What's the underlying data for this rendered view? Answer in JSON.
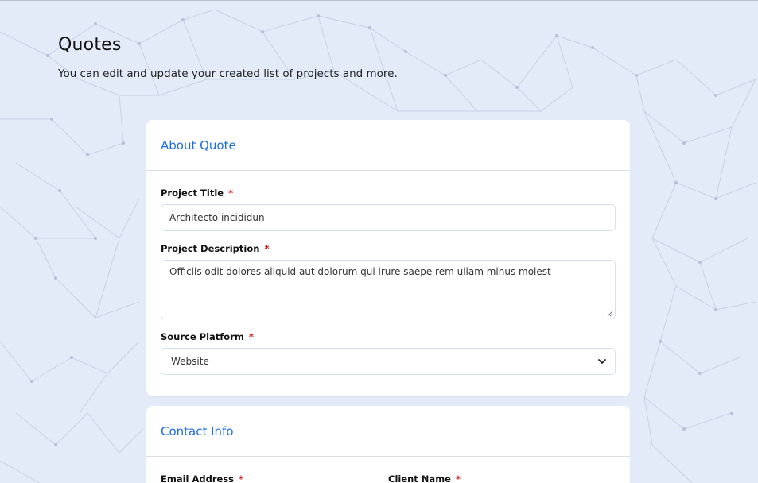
{
  "page": {
    "title": "Quotes",
    "subtitle": "You can edit and update your created list of projects and more."
  },
  "about_quote": {
    "heading": "About Quote",
    "project_title": {
      "label": "Project Title",
      "required_mark": "*",
      "value": "Architecto incididun"
    },
    "project_description": {
      "label": "Project Description",
      "required_mark": "*",
      "value": "Officiis odit dolores aliquid aut dolorum qui irure saepe rem ullam minus molest"
    },
    "source_platform": {
      "label": "Source Platform",
      "required_mark": "*",
      "selected": "Website"
    }
  },
  "contact_info": {
    "heading": "Contact Info",
    "email": {
      "label": "Email Address",
      "required_mark": "*"
    },
    "client_name": {
      "label": "Client Name",
      "required_mark": "*"
    }
  },
  "colors": {
    "background": "#e4ebf8",
    "accent": "#1f6fe0",
    "required": "#d31b1b",
    "card": "#ffffff"
  },
  "icons": {
    "select_toggle": "chevron-down-icon",
    "textarea_resize": "resize-handle-icon"
  }
}
